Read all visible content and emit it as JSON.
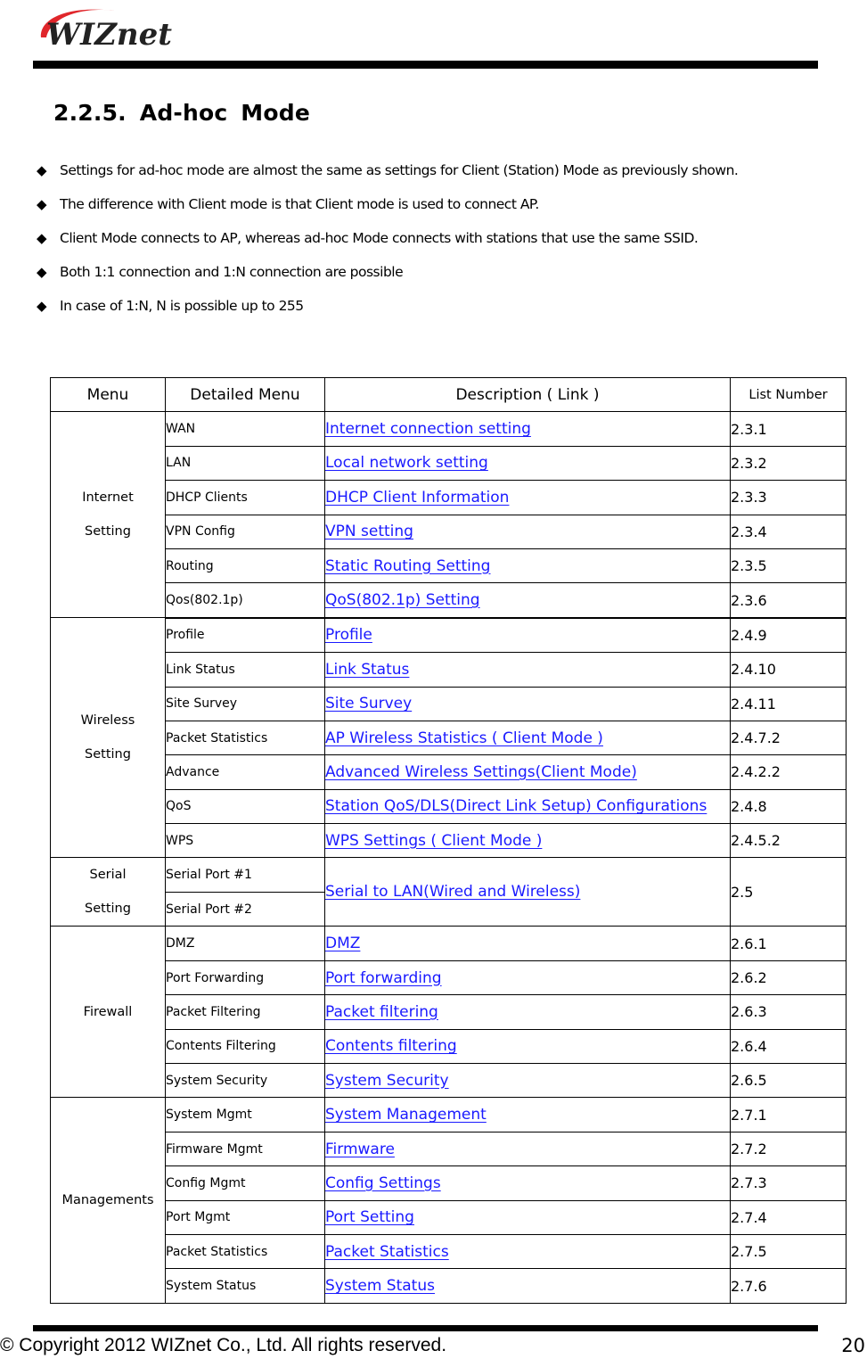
{
  "header": {
    "logo_text": "WIZnet",
    "logo_arc_color": "#e0262b"
  },
  "section": {
    "title": "2.2.5.  Ad-hoc  Mode"
  },
  "bullets": [
    {
      "glyph": "◆",
      "text": "Settings for ad-hoc mode are almost the same as settings for Client (Station) Mode as previously shown."
    },
    {
      "glyph": "◆",
      "text": "The difference with Client mode is that Client mode is used to connect AP."
    },
    {
      "glyph": "◆",
      "text": "Client Mode connects to AP, whereas ad-hoc Mode connects with stations that use the same SSID."
    },
    {
      "glyph": "◆",
      "text": "Both 1:1 connection and 1:N connection are possible"
    },
    {
      "glyph": "◆",
      "text": "In case of 1:N, N is possible up to 255"
    }
  ],
  "table": {
    "headers": [
      "Menu",
      "Detailed Menu",
      "Description ( Link )",
      "List Number"
    ],
    "link_color": "#1a1aff",
    "groups": [
      {
        "menu_line1": "Internet",
        "menu_line2": "Setting",
        "rows": [
          {
            "detail": "WAN",
            "desc": "Internet connection setting",
            "num": "2.3.1"
          },
          {
            "detail": "LAN",
            "desc": "Local network setting",
            "num": "2.3.2"
          },
          {
            "detail": "DHCP Clients",
            "desc": "DHCP Client Information",
            "num": "2.3.3"
          },
          {
            "detail": "VPN Config",
            "desc": "VPN setting",
            "num": "2.3.4"
          },
          {
            "detail": "Routing",
            "desc": "Static Routing Setting",
            "num": "2.3.5"
          },
          {
            "detail": "Qos(802.1p)",
            "desc": "QoS(802.1p) Setting",
            "num": "2.3.6"
          }
        ]
      },
      {
        "menu_line1": "Wireless",
        "menu_line2": "Setting",
        "rows": [
          {
            "detail": "Profile",
            "desc": "Profile",
            "num": "2.4.9"
          },
          {
            "detail": "Link Status",
            "desc": "Link Status",
            "num": "2.4.10"
          },
          {
            "detail": "Site Survey",
            "desc": "Site Survey",
            "num": "2.4.11"
          },
          {
            "detail": "Packet Statistics",
            "desc": "AP Wireless Statistics ( Client Mode )",
            "num": "2.4.7.2"
          },
          {
            "detail": "Advance",
            "desc": "Advanced Wireless Settings(Client Mode)",
            "num": "2.4.2.2"
          },
          {
            "detail": "QoS",
            "desc": "Station QoS/DLS(Direct Link Setup) Configurations",
            "num": "2.4.8"
          },
          {
            "detail": "WPS",
            "desc": "WPS Settings ( Client Mode )",
            "num": "2.4.5.2"
          }
        ]
      },
      {
        "menu_line1": "Serial",
        "menu_line2": "Setting",
        "rows": [
          {
            "detail": "Serial Port #1"
          },
          {
            "detail": "Serial Port #2"
          }
        ],
        "shared_desc": "Serial to LAN(Wired and Wireless)",
        "shared_num": "2.5"
      },
      {
        "menu_line1": "Firewall",
        "menu_line2": "",
        "rows": [
          {
            "detail": "DMZ",
            "desc": "DMZ",
            "num": "2.6.1"
          },
          {
            "detail": "Port Forwarding",
            "desc": "Port forwarding",
            "num": "2.6.2"
          },
          {
            "detail": "Packet Filtering",
            "desc": "Packet filtering",
            "num": "2.6.3"
          },
          {
            "detail": "Contents Filtering",
            "desc": "Contents filtering",
            "num": "2.6.4"
          },
          {
            "detail": "System Security",
            "desc": "System Security",
            "num": "2.6.5"
          }
        ]
      },
      {
        "menu_line1": "Managements",
        "menu_line2": "",
        "rows": [
          {
            "detail": "System Mgmt",
            "desc": "System Management",
            "num": "2.7.1"
          },
          {
            "detail": "Firmware Mgmt",
            "desc": "Firmware",
            "num": "2.7.2"
          },
          {
            "detail": "Config Mgmt",
            "desc": "Config Settings",
            "num": "2.7.3"
          },
          {
            "detail": "Port Mgmt",
            "desc": "Port Setting",
            "num": "2.7.4"
          },
          {
            "detail": "Packet Statistics",
            "desc": "Packet Statistics",
            "num": "2.7.5"
          },
          {
            "detail": "System Status",
            "desc": "System Status",
            "num": "2.7.6"
          }
        ]
      }
    ]
  },
  "footer": {
    "copyright": "© Copyright 2012 WIZnet Co., Ltd. All rights reserved.",
    "page_number": "20"
  }
}
